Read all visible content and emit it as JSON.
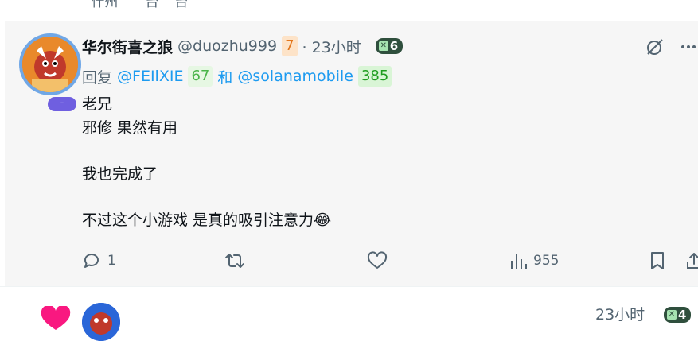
{
  "top_cut_text": "⁻ 什州 ⁻ ⁻ 台 ⁻ 台",
  "post": {
    "author": {
      "display_name": "华尔街喜之狼",
      "handle": "@duozhu999",
      "score": "7",
      "time": "· 23小时",
      "x_badge_count": "6",
      "avatar_badge": "-"
    },
    "reply": {
      "prefix": "回复",
      "mentions": [
        {
          "handle": "@FEIlXIE",
          "score": "67"
        },
        {
          "handle": "@solanamobile",
          "score": "385"
        }
      ],
      "joiner": "和"
    },
    "body_lines": [
      "老兄",
      "邪修 果然有用",
      "",
      "我也完成了",
      "",
      "不过这个小游戏 是真的吸引注意力😂"
    ],
    "actions": {
      "reply_count": "1",
      "retweet_count": "",
      "like_count": "",
      "views_count": "955"
    }
  },
  "next_post": {
    "time": "23小时",
    "x_badge_count": "4"
  },
  "colors": {
    "accent": "#1d9bf0",
    "muted": "#536471",
    "badge_bg": "#2f4f3d",
    "avatar_ring": "#70a7e6",
    "avatar_pill": "#6f5fe0",
    "heart": "#f91880"
  },
  "icons": {
    "top_right": [
      "no-link-icon",
      "more-icon"
    ],
    "actions": [
      "reply-icon",
      "retweet-icon",
      "like-icon",
      "views-icon",
      "bookmark-icon",
      "share-icon"
    ]
  }
}
